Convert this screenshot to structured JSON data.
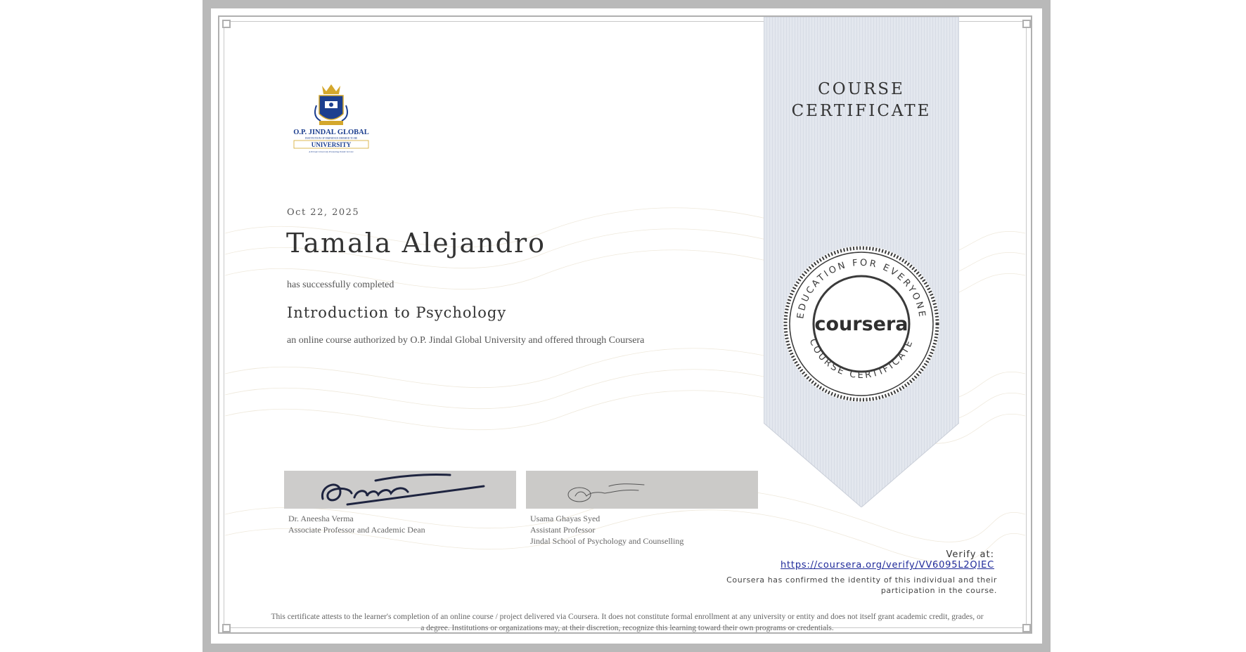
{
  "certificate": {
    "ribbon_title_line1": "COURSE",
    "ribbon_title_line2": "CERTIFICATE",
    "date": "Oct 22, 2025",
    "recipient_name": "Tamala Alejandro",
    "completed_text": "has successfully completed",
    "course_title": "Introduction to Psychology",
    "authorized_text": "an online course authorized by O.P. Jindal Global University and offered through Coursera"
  },
  "logo": {
    "line1": "O.P. JINDAL GLOBAL",
    "line2": "INSTITUTION OF EMINENCE DEEMED TO BE",
    "line3": "UNIVERSITY",
    "line4": "A Private University Promoting Public Service"
  },
  "seal": {
    "brand": "coursera",
    "ring_top": "EDUCATION FOR EVERYONE",
    "ring_bottom": "COURSE CERTIFICATE"
  },
  "signatories": [
    {
      "name": "Dr. Aneesha Verma",
      "title": "Associate Professor and Academic Dean",
      "org": ""
    },
    {
      "name": "Usama Ghayas Syed",
      "title": "Assistant Professor",
      "org": "Jindal School of Psychology and Counselling"
    }
  ],
  "verify": {
    "label": "Verify at:",
    "url": "https://coursera.org/verify/VV6095L2QIEC",
    "confirmed_line1": "Coursera has confirmed the identity of this individual and their",
    "confirmed_line2": "participation in the course."
  },
  "disclaimer": {
    "line1": "This certificate attests to the learner's completion of an online course / project delivered via Coursera. It does not constitute formal enrollment at any university or entity and does not itself grant academic credit, grades, or",
    "line2": "a degree. Institutions or organizations may, at their discretion, recognize this learning toward their own programs or credentials."
  },
  "colors": {
    "ribbon": "#e3e7ee",
    "frame": "#b9b9b9",
    "link": "#1f2a9a",
    "seal_dark": "#3a3a3a"
  }
}
